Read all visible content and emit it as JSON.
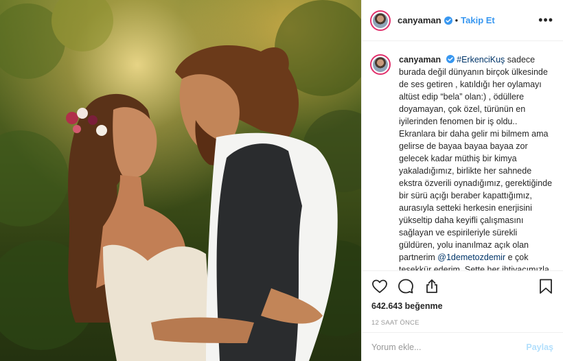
{
  "header": {
    "username": "canyaman",
    "separator": "•",
    "follow_label": "Takip Et",
    "more_label": "•••"
  },
  "caption": {
    "username": "canyaman",
    "hashtag": "#ErkenciKuş",
    "text_part1": " sadece burada değil dünyanın birçok ülkesinde de ses getiren , katıldığı her oylamayı altüst edip “bela” olan:) , ödüllere doyamayan, çok özel, türünün en iyilerinden fenomen bir iş oldu.. Ekranlara bir daha gelir mi bilmem ama gelirse de bayaa bayaa bayaa zor gelecek kadar müthiş bir kimya yakaladığımız, birlikte her sahnede ekstra özverili oynadığımız, gerektiğinde bir sürü açığı beraber kapattığımız, aurasıyla setteki herkesin enerjisini yükseltip daha keyifli çalışmasını sağlayan ve espirileriyle sürekli güldüren, yolu inanılmaz açık olan partnerim ",
    "mention": "@1demetozdemir",
    "text_part2": " e çok teşekkür ederim. Sette her ihtiyacımızla ilgilenmeye çalışan, işimizi kolaylaştıran set ve prodüksiyon çalışanlarına ("
  },
  "icons": {
    "verified": "verified-badge-icon",
    "like": "heart-icon",
    "comment": "comment-icon",
    "share": "share-icon",
    "save": "bookmark-icon"
  },
  "stats": {
    "likes": "642.643 beğenme",
    "time": "12 SAAT ÖNCE"
  },
  "comment_box": {
    "placeholder": "Yorum ekle...",
    "submit_label": "Paylaş"
  },
  "colors": {
    "link": "#3897f0",
    "hashtag": "#003569",
    "submit_disabled": "#b2dffc",
    "meta": "#999999"
  }
}
